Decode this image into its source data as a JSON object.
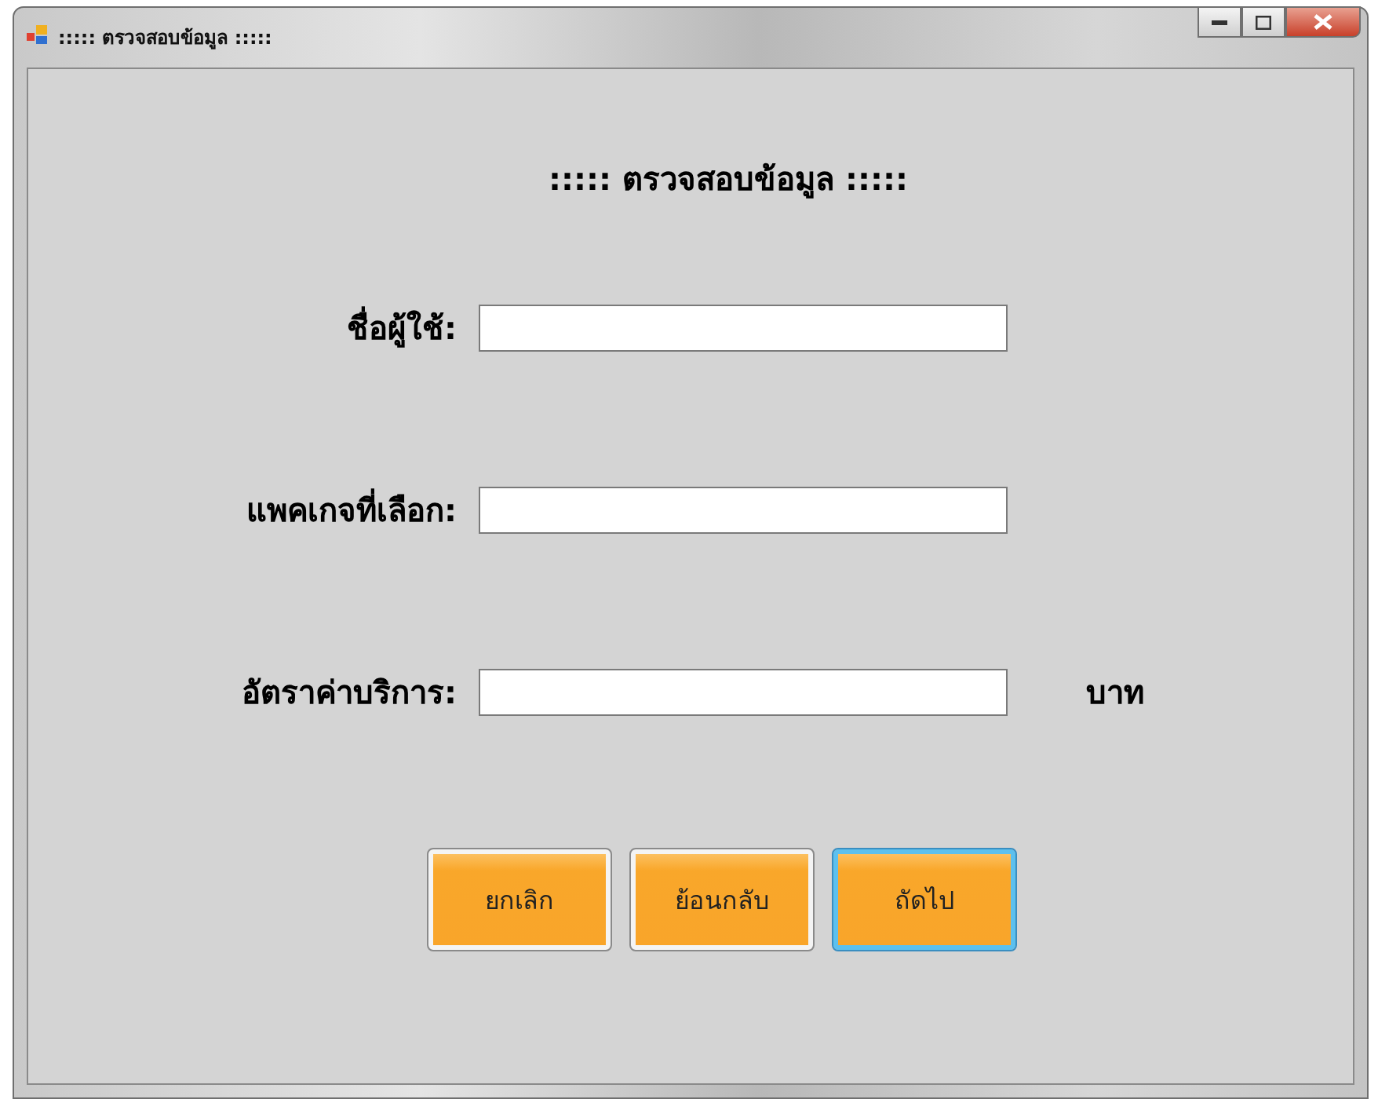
{
  "window": {
    "title": "::::: ตรวจสอบข้อมูล :::::"
  },
  "heading": "::::: ตรวจสอบข้อมูล :::::",
  "fields": [
    {
      "label": "ชื่อผู้ใช้:"
    },
    {
      "label": "แพคเกจที่เลือก:"
    },
    {
      "label": "อัตราค่าบริการ:",
      "unit": "บาท"
    }
  ],
  "buttons": [
    {
      "label": "ยกเลิก",
      "focused": false
    },
    {
      "label": "ย้อนกลับ",
      "focused": false
    },
    {
      "label": "ถัดไป",
      "focused": true
    }
  ]
}
